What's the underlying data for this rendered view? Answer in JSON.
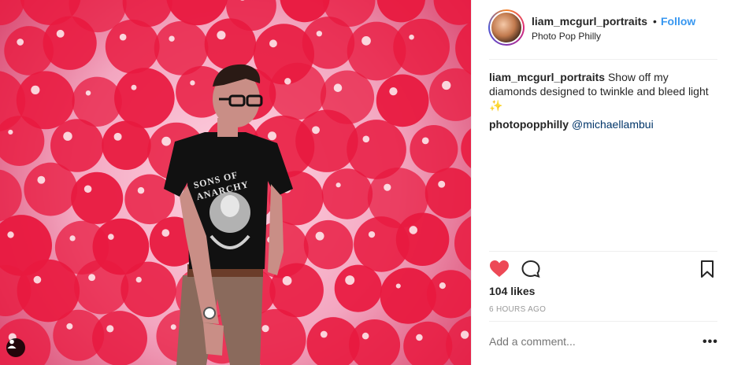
{
  "post": {
    "username": "liam_mcgurl_portraits",
    "separator": "•",
    "follow_label": "Follow",
    "location": "Photo Pop Philly",
    "caption_user": "liam_mcgurl_portraits",
    "caption_text": "Show off my diamonds designed to twinkle and bleed light ✨",
    "comment_user": "photopopphilly",
    "comment_mention": "@michaellambui",
    "likes": "104 likes",
    "timestamp": "6 HOURS AGO",
    "add_comment_placeholder": "Add a comment...",
    "more_label": "•••"
  },
  "photo": {
    "shirt_text": "SONS OF ANARCHY"
  },
  "colors": {
    "accent_blue": "#3897f0",
    "mention_blue": "#003569",
    "heart_red": "#ed4956",
    "balloon_red": "#e8193f",
    "muted_gray": "#999999"
  },
  "icons": {
    "heart": "heart-filled-icon",
    "comment": "comment-bubble-icon",
    "bookmark": "bookmark-icon",
    "user_tag": "user-tag-icon"
  }
}
